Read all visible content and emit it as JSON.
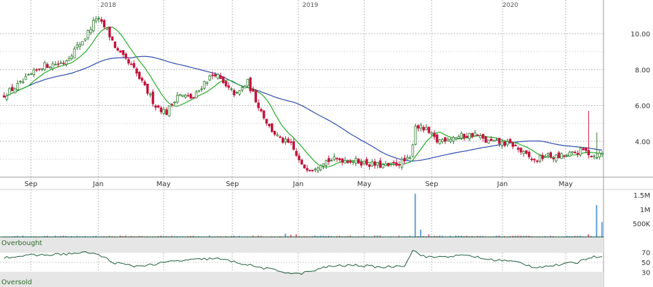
{
  "colors": {
    "up": "#2e7d2e",
    "down": "#c0143c",
    "ma_short": "#22aa22",
    "ma_long": "#2a4aa8",
    "volume": "#6fa8dc",
    "volume_down": "#e07a8f",
    "rsi": "#1a5a3a",
    "grid": "#b8b8b8",
    "band": "#e6e6e6"
  },
  "chart_data": [
    {
      "type": "candlestick",
      "year_labels": [
        "2018",
        "2019",
        "2020"
      ],
      "x_tick_labels": [
        "Sep",
        "Jan",
        "May",
        "Sep",
        "Jan",
        "May",
        "Sep",
        "Jan",
        "May"
      ],
      "y_tick_labels": [
        "10.00",
        "8.00",
        "6.00",
        "4.00"
      ],
      "ylim": [
        2.0,
        11.5
      ],
      "grid": true,
      "price_path": [
        [
          0,
          6.6
        ],
        [
          6,
          7.2
        ],
        [
          14,
          8.2
        ],
        [
          22,
          8.4
        ],
        [
          30,
          9.8
        ],
        [
          34,
          10.9
        ],
        [
          38,
          10.2
        ],
        [
          42,
          9.0
        ],
        [
          48,
          8.0
        ],
        [
          52,
          7.0
        ],
        [
          56,
          6.0
        ],
        [
          60,
          5.6
        ],
        [
          64,
          6.6
        ],
        [
          70,
          6.4
        ],
        [
          74,
          7.3
        ],
        [
          78,
          7.8
        ],
        [
          82,
          7.0
        ],
        [
          86,
          6.6
        ],
        [
          90,
          7.3
        ],
        [
          94,
          6.0
        ],
        [
          98,
          4.8
        ],
        [
          102,
          4.1
        ],
        [
          106,
          3.8
        ],
        [
          110,
          2.6
        ],
        [
          114,
          2.5
        ],
        [
          118,
          2.9
        ],
        [
          124,
          3.0
        ],
        [
          130,
          2.9
        ],
        [
          136,
          2.7
        ],
        [
          142,
          2.6
        ],
        [
          146,
          2.8
        ],
        [
          150,
          3.0
        ],
        [
          152,
          4.9
        ],
        [
          156,
          4.6
        ],
        [
          160,
          4.0
        ],
        [
          164,
          4.2
        ],
        [
          170,
          4.3
        ],
        [
          174,
          4.4
        ],
        [
          178,
          4.0
        ],
        [
          184,
          3.9
        ],
        [
          188,
          3.8
        ],
        [
          192,
          3.3
        ],
        [
          196,
          2.9
        ],
        [
          200,
          3.2
        ],
        [
          204,
          3.1
        ],
        [
          210,
          3.3
        ],
        [
          214,
          3.5
        ],
        [
          218,
          3.2
        ],
        [
          221,
          3.3
        ]
      ],
      "volume_tick_labels": [
        "1.5M",
        "1M",
        "500K"
      ],
      "volume_spikes": [
        [
          152,
          1.55
        ],
        [
          154,
          0.28
        ],
        [
          157,
          0.12
        ],
        [
          104,
          0.14
        ],
        [
          106,
          0.1
        ],
        [
          108,
          0.12
        ],
        [
          219,
          1.15
        ],
        [
          221,
          0.55
        ],
        [
          216,
          0.12
        ]
      ],
      "rsi_labels": {
        "overbought": "Overbought",
        "oversold": "Oversold"
      },
      "rsi_tick_labels": [
        "70",
        "50",
        "30"
      ],
      "rsi_levels": [
        70,
        50,
        30
      ],
      "rsi_path": [
        [
          0,
          60
        ],
        [
          10,
          64
        ],
        [
          20,
          66
        ],
        [
          32,
          70
        ],
        [
          37,
          60
        ],
        [
          40,
          50
        ],
        [
          48,
          42
        ],
        [
          56,
          46
        ],
        [
          62,
          52
        ],
        [
          70,
          55
        ],
        [
          78,
          58
        ],
        [
          84,
          52
        ],
        [
          86,
          50
        ],
        [
          94,
          40
        ],
        [
          100,
          34
        ],
        [
          108,
          26
        ],
        [
          114,
          32
        ],
        [
          120,
          42
        ],
        [
          130,
          44
        ],
        [
          140,
          40
        ],
        [
          148,
          44
        ],
        [
          151,
          74
        ],
        [
          156,
          60
        ],
        [
          164,
          62
        ],
        [
          172,
          64
        ],
        [
          178,
          56
        ],
        [
          184,
          54
        ],
        [
          190,
          50
        ],
        [
          196,
          40
        ],
        [
          204,
          44
        ],
        [
          212,
          50
        ],
        [
          216,
          60
        ],
        [
          221,
          62
        ]
      ]
    }
  ]
}
